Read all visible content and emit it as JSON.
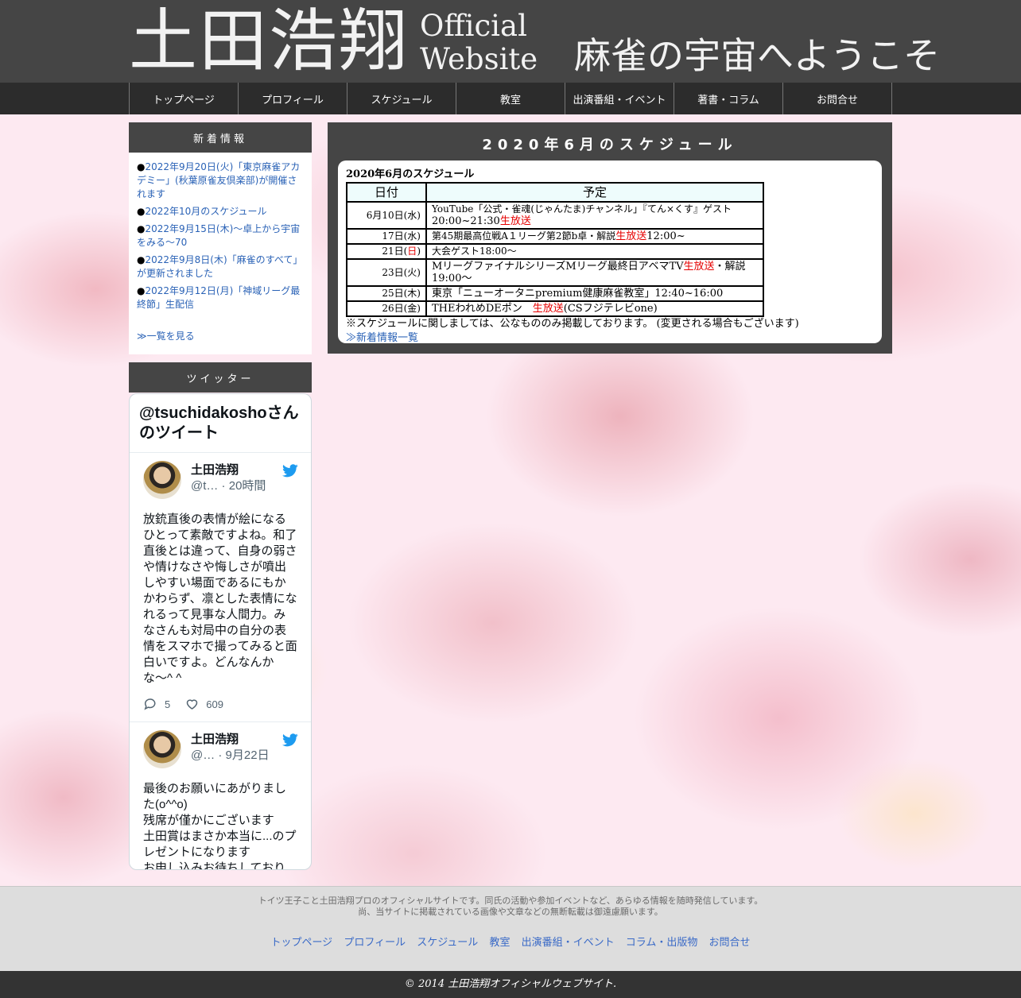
{
  "header": {
    "logo_main": "土田浩翔",
    "logo_sub_line1": "Official",
    "logo_sub_line2": "Website",
    "welcome": "麻雀の宇宙へようこそ"
  },
  "nav": [
    "トップページ",
    "プロフィール",
    "スケジュール",
    "教室",
    "出演番組・イベント",
    "著書・コラム",
    "お問合せ"
  ],
  "sidebar": {
    "news_title": "新着情報",
    "news": [
      "2022年9月20日(火)「東京麻雀アカデミー」(秋葉原雀友倶楽部)が開催されます",
      "2022年10月のスケジュール",
      "2022年9月15日(木)～卓上から宇宙をみる～70",
      "2022年9月8日(木)「麻雀のすべて」が更新されました",
      "2022年9月12日(月)「神域リーグ最終節」生配信"
    ],
    "news_bullet": "●",
    "news_more": "≫一覧を見る",
    "twitter_title": "ツイッター"
  },
  "twitter": {
    "heading": "@tsuchidakoshoさんのツイート",
    "tweets": [
      {
        "name": "土田浩翔",
        "meta": "@t… · 20時間",
        "text": "放銃直後の表情が絵になるひとって素敵ですよね。和了直後とは違って、自身の弱さや情けなさや悔しさが噴出しやすい場面であるにもかかわらず、凛とした表情になれるって見事な人間力。みなさんも対局中の自分の表情をスマホで撮ってみると面白いですよ。どんなんかな〜^ ^",
        "replies": "5",
        "likes": "609"
      },
      {
        "name": "土田浩翔",
        "meta": "@… · 9月22日",
        "text": "最後のお願いにあがりました(o^^o)\n残席が僅かにございます\n土田賞はまさか本当に...のプレゼントになります\nお申し込みお待ちしており"
      }
    ]
  },
  "main": {
    "title": "2020年6月のスケジュール",
    "heading": "2020年6月のスケジュール",
    "table_headers": [
      "日付",
      "予定"
    ],
    "rows": [
      {
        "date": "6月10日(水)",
        "parts": [
          "YouTube「公式・雀魂(じゃんたま)チャンネル」『てん×くす』ゲスト",
          "20:00~21:30",
          "生放送",
          ""
        ]
      },
      {
        "date": "17日(水)",
        "parts": [
          "第45期最高位戦A１リーグ第2節b卓・解説",
          "生放送",
          "12:00~"
        ]
      },
      {
        "date_prefix": "21日(",
        "date_red": "日",
        "date_suffix": ")",
        "text": "大会ゲスト18:00～"
      },
      {
        "date": "23日(火)",
        "parts": [
          "MリーグファイナルシリーズMリーグ最終日アベマTV",
          "生放送",
          "・解説19:00〜"
        ]
      },
      {
        "date": "25日(木)",
        "text": "東京「ニューオータニpremium健康麻雀教室」12:40~16:00"
      },
      {
        "date": "26日(金)",
        "parts": [
          "THEわれめDEポン　",
          "生放送",
          "(CSフジテレビone)"
        ]
      }
    ],
    "note": "※スケジュールに関しましては、公なもののみ掲載しております。 (変更される場合もございます)",
    "news_list_link": "≫新着情報一覧"
  },
  "footer": {
    "line1": "トイツ王子こと土田浩翔プロのオフィシャルサイトです。同氏の活動や参加イベントなど、あらゆる情報を随時発信しています。",
    "line2": "尚、当サイトに掲載されている画像や文章などの無断転載は御遠慮願います。",
    "links": [
      "トップページ",
      "プロフィール",
      "スケジュール",
      "教室",
      "出演番組・イベント",
      "コラム・出版物",
      "お問合せ"
    ],
    "copyright": "© 2014 土田浩翔オフィシャルウェブサイト."
  },
  "colors": {
    "header_bg": "#454545",
    "nav_bg": "#2c2c2c",
    "link": "#2a62b6",
    "live_red": "#e60000",
    "table_header_bg": "#eefcfc",
    "footer_bg": "#dddddd",
    "twitter_blue": "#1d9bf0"
  },
  "icons": [
    "twitter-bird-icon",
    "reply-icon",
    "like-icon"
  ]
}
